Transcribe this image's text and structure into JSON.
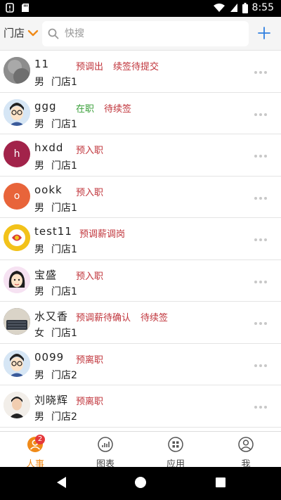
{
  "status_bar": {
    "time": "8:55"
  },
  "header": {
    "store_filter": "门店",
    "search_placeholder": "快搜"
  },
  "employees": [
    {
      "name": "11",
      "avatar_letter": "",
      "avatar_color": "#8a8a8a",
      "tags": [
        {
          "text": "预调出",
          "color": "#c0343b"
        },
        {
          "text": "续签待提交",
          "color": "#c0343b"
        }
      ],
      "gender": "男",
      "store": "门店1"
    },
    {
      "name": "ggg",
      "avatar_letter": "",
      "avatar_color": "#cfe0f2",
      "tags": [
        {
          "text": "在职",
          "color": "#3aa03a"
        },
        {
          "text": "待续签",
          "color": "#c0343b"
        }
      ],
      "gender": "男",
      "store": "门店1"
    },
    {
      "name": "hxdd",
      "avatar_letter": "h",
      "avatar_color": "#a2234a",
      "tags": [
        {
          "text": "预入职",
          "color": "#c0343b"
        }
      ],
      "gender": "男",
      "store": "门店1"
    },
    {
      "name": "ookk",
      "avatar_letter": "o",
      "avatar_color": "#e8643a",
      "tags": [
        {
          "text": "预入职",
          "color": "#c0343b"
        }
      ],
      "gender": "男",
      "store": "门店1"
    },
    {
      "name": "test11",
      "avatar_letter": "",
      "avatar_color": "#f2c21a",
      "tags": [
        {
          "text": "预调薪调岗",
          "color": "#c0343b"
        }
      ],
      "gender": "男",
      "store": "门店1"
    },
    {
      "name": "宝盛",
      "avatar_letter": "",
      "avatar_color": "#f3d9ef",
      "tags": [
        {
          "text": "预入职",
          "color": "#c0343b"
        }
      ],
      "gender": "男",
      "store": "门店1"
    },
    {
      "name": "水又香",
      "avatar_letter": "",
      "avatar_color": "#3a3f48",
      "tags": [
        {
          "text": "预调薪待确认",
          "color": "#c0343b"
        },
        {
          "text": "待续签",
          "color": "#c0343b"
        }
      ],
      "gender": "女",
      "store": "门店1"
    },
    {
      "name": "0099",
      "avatar_letter": "",
      "avatar_color": "#cfe0f2",
      "tags": [
        {
          "text": "预离职",
          "color": "#c0343b"
        }
      ],
      "gender": "男",
      "store": "门店2"
    },
    {
      "name": "刘晓辉",
      "avatar_letter": "",
      "avatar_color": "#e9e2da",
      "tags": [
        {
          "text": "预离职",
          "color": "#c0343b"
        }
      ],
      "gender": "男",
      "store": "门店2"
    }
  ],
  "tabbar": {
    "tabs": [
      {
        "label": "人事",
        "icon": "person-icon",
        "active": true,
        "badge": "2"
      },
      {
        "label": "图表",
        "icon": "chart-icon",
        "active": false
      },
      {
        "label": "应用",
        "icon": "apps-icon",
        "active": false
      },
      {
        "label": "我",
        "icon": "profile-icon",
        "active": false
      }
    ]
  },
  "colors": {
    "accent": "#f08a18",
    "tag_red": "#c0343b",
    "tag_green": "#3aa03a",
    "link_blue": "#2f7fe0"
  }
}
